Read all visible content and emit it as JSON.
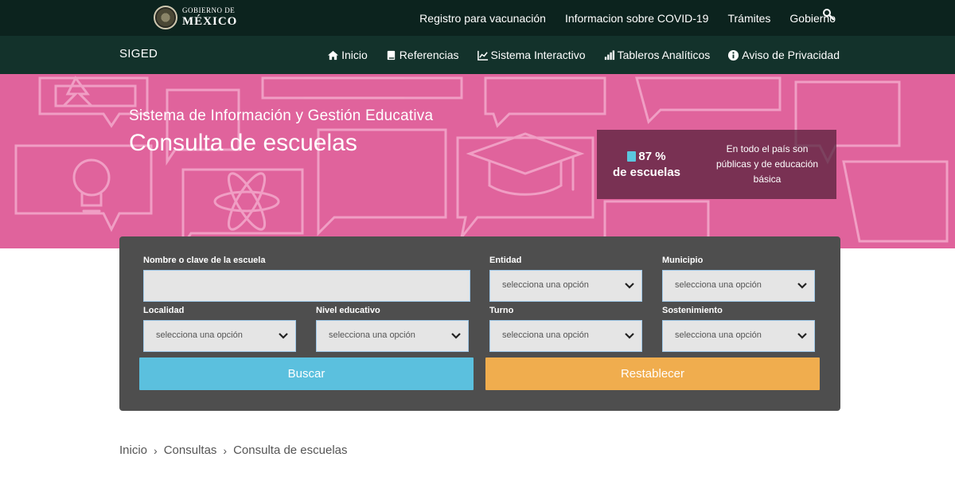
{
  "gov_header": {
    "logo_line1": "GOBIERNO DE",
    "logo_line2": "MÉXICO",
    "links": [
      "Registro para vacunación",
      "Informacion sobre COVID-19",
      "Trámites",
      "Gobierno"
    ],
    "search_icon": "search-icon"
  },
  "site_nav": {
    "brand": "SIGED",
    "items": [
      {
        "label": "Inicio",
        "icon": "home-icon"
      },
      {
        "label": "Referencias",
        "icon": "book-icon"
      },
      {
        "label": "Sistema Interactivo",
        "icon": "line-chart-icon"
      },
      {
        "label": "Tableros Analíticos",
        "icon": "bar-chart-icon"
      },
      {
        "label": "Aviso de Privacidad",
        "icon": "info-circle-icon"
      }
    ]
  },
  "hero": {
    "subtitle": "Sistema de Información y Gestión Educativa",
    "title": "Consulta de escuelas",
    "stat_value": "87 %",
    "stat_label": "de escuelas",
    "stat_desc": "En todo el país son públicas y de educación básica",
    "background_color": "#e0639c"
  },
  "search_form": {
    "school_label": "Nombre o clave de la escuela",
    "school_value": "",
    "entidad_label": "Entidad",
    "municipio_label": "Municipio",
    "localidad_label": "Localidad",
    "nivel_label": "Nivel educativo",
    "turno_label": "Turno",
    "sostenimiento_label": "Sostenimiento",
    "select_placeholder": "selecciona una opción",
    "search_button": "Buscar",
    "reset_button": "Restablecer",
    "search_color": "#5bc0de",
    "reset_color": "#f0ad4e"
  },
  "breadcrumb": {
    "items": [
      "Inicio",
      "Consultas",
      "Consulta de escuelas"
    ],
    "separator": "›"
  },
  "colors": {
    "gov_bar": "#0c231e",
    "nav_bar": "#13322b",
    "panel": "#4e4e4e"
  }
}
